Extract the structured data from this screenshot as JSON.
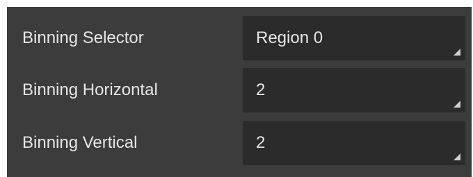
{
  "properties": [
    {
      "label": "Binning Selector",
      "value": "Region 0",
      "icon": "dropdown-corner-icon"
    },
    {
      "label": "Binning Horizontal",
      "value": "2",
      "icon": "dropdown-corner-icon"
    },
    {
      "label": "Binning Vertical",
      "value": "2",
      "icon": "dropdown-corner-icon"
    }
  ],
  "colors": {
    "panel_background": "#3c3c3c",
    "field_background": "#2b2b2b",
    "text": "#e6e6e6"
  }
}
